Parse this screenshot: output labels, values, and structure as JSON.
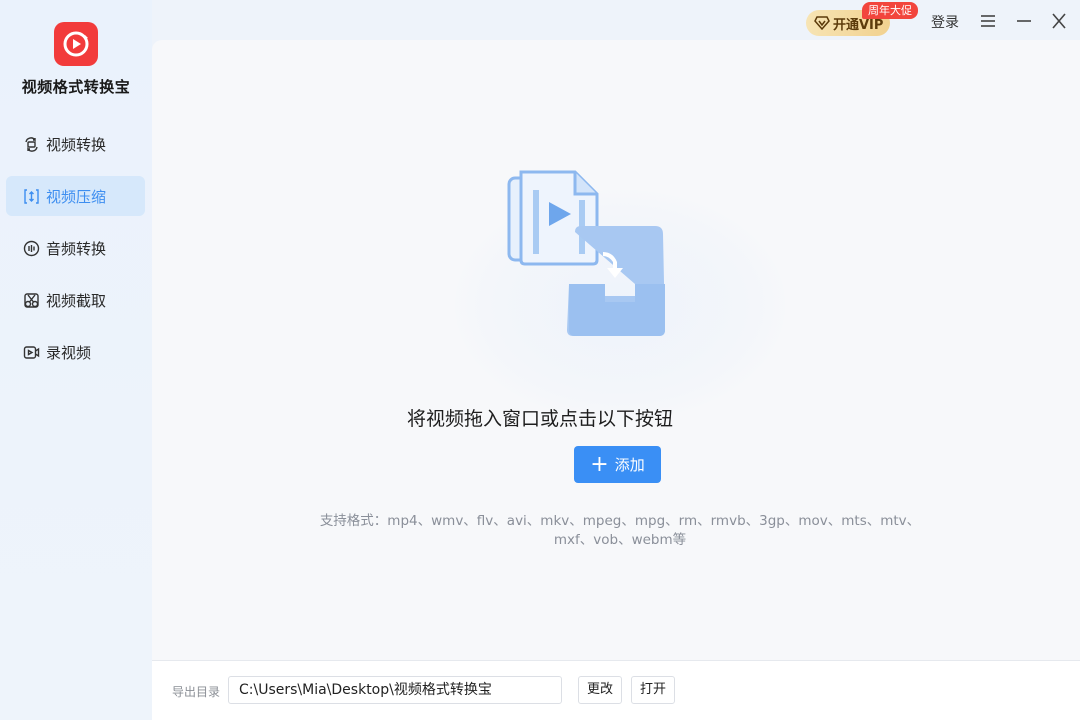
{
  "app": {
    "name": "视频格式转换宝",
    "logo_icon": "video-convert-logo-icon",
    "brand_color": "#f23b3b"
  },
  "sidebar": {
    "items": [
      {
        "label": "视频转换",
        "icon": "convert-icon",
        "active": false
      },
      {
        "label": "视频压缩",
        "icon": "compress-icon",
        "active": true
      },
      {
        "label": "音频转换",
        "icon": "audio-icon",
        "active": false
      },
      {
        "label": "视频截取",
        "icon": "cut-icon",
        "active": false
      },
      {
        "label": "录视频",
        "icon": "record-icon",
        "active": false
      }
    ]
  },
  "titlebar": {
    "vip_label": "开通VIP",
    "promo_badge": "周年大促",
    "login_label": "登录",
    "menu_icon": "menu-icon",
    "minimize_icon": "minimize-icon",
    "close_icon": "close-icon"
  },
  "main": {
    "drop_hint": "将视频拖入窗口或点击以下按钮",
    "add_label": "添加",
    "formats_line1": "支持格式：mp4、wmv、flv、avi、mkv、mpeg、mpg、rm、rmvb、3gp、mov、mts、mtv、",
    "formats_line2": "mxf、vob、webm等",
    "accent_color": "#3a8ff5"
  },
  "bottom": {
    "output_label": "导出目录",
    "output_path": "C:\\Users\\Mia\\Desktop\\视频格式转换宝",
    "change_label": "更改",
    "open_label": "打开"
  }
}
